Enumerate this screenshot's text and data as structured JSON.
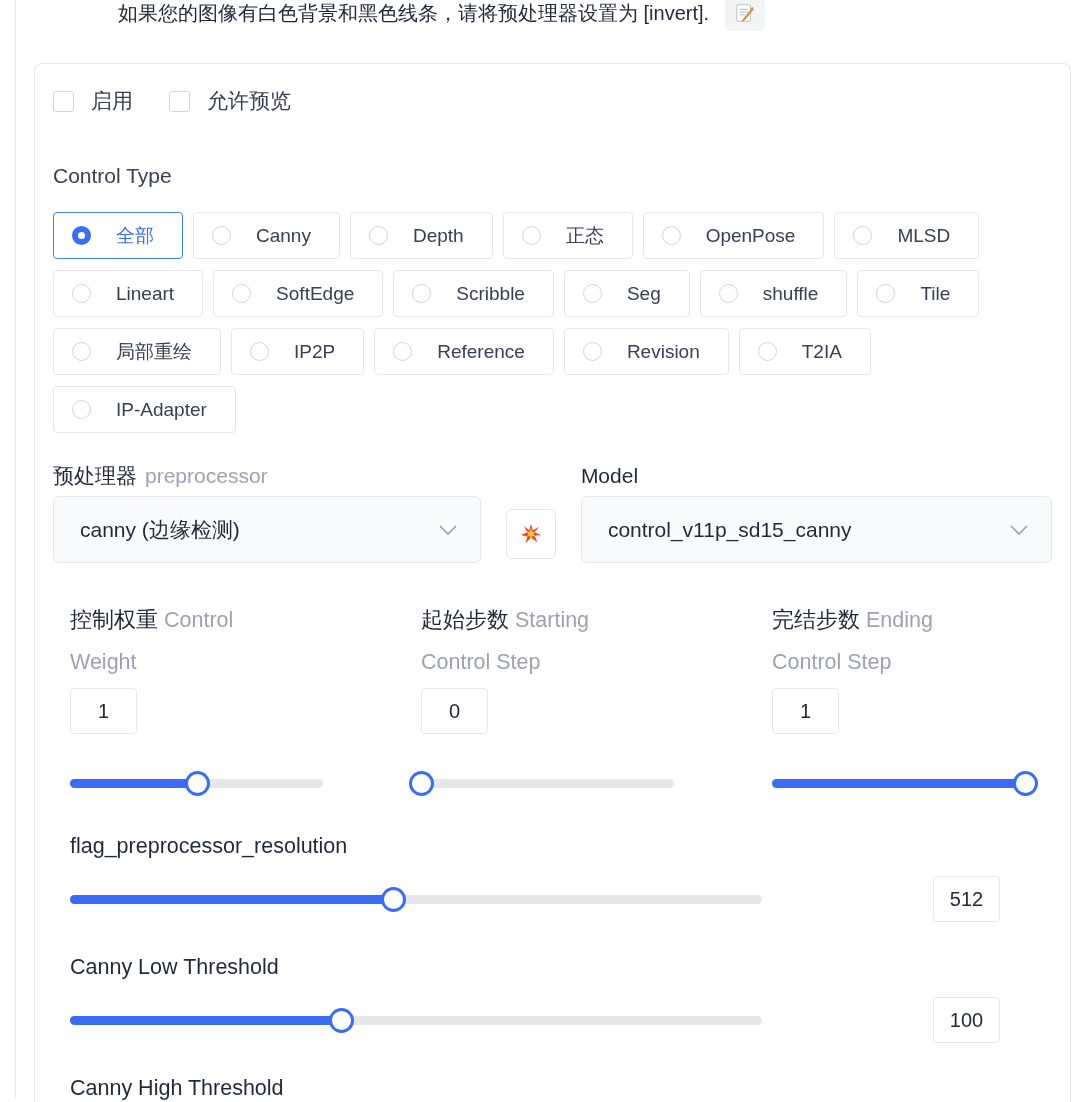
{
  "note": {
    "text": "如果您的图像有白色背景和黑色线条，请将预处理器设置为 [invert]."
  },
  "options": [
    {
      "label": "启用",
      "checked": false
    },
    {
      "label": "允许预览",
      "checked": false
    }
  ],
  "control_type": {
    "label": "Control Type",
    "types": [
      {
        "label": "全部",
        "selected": true
      },
      {
        "label": "Canny",
        "selected": false
      },
      {
        "label": "Depth",
        "selected": false
      },
      {
        "label": "正态",
        "selected": false
      },
      {
        "label": "OpenPose",
        "selected": false
      },
      {
        "label": "MLSD",
        "selected": false
      },
      {
        "label": "Lineart",
        "selected": false
      },
      {
        "label": "SoftEdge",
        "selected": false
      },
      {
        "label": "Scribble",
        "selected": false
      },
      {
        "label": "Seg",
        "selected": false
      },
      {
        "label": "shuffle",
        "selected": false
      },
      {
        "label": "Tile",
        "selected": false
      },
      {
        "label": "局部重绘",
        "selected": false
      },
      {
        "label": "IP2P",
        "selected": false
      },
      {
        "label": "Reference",
        "selected": false
      },
      {
        "label": "Revision",
        "selected": false
      },
      {
        "label": "T2IA",
        "selected": false
      },
      {
        "label": "IP-Adapter",
        "selected": false
      }
    ]
  },
  "preprocessor": {
    "label": "预处理器",
    "hint": "preprocessor",
    "value": "canny (边缘检测)"
  },
  "model": {
    "label": "Model",
    "value": "control_v11p_sd15_canny"
  },
  "step_sliders": [
    {
      "label": "控制权重",
      "hint": "Control Weight",
      "value": "1",
      "level": 0.5
    },
    {
      "label": "起始步数",
      "hint": "Starting Control Step",
      "value": "0",
      "level": 0
    },
    {
      "label": "完结步数",
      "hint": "Ending Control Step",
      "value": "1",
      "level": 1
    }
  ],
  "sliders": [
    {
      "label": "flag_preprocessor_resolution",
      "value": "512",
      "level": 0.467
    },
    {
      "label": "Canny Low Threshold",
      "value": "100",
      "level": 0.392
    },
    {
      "label": "Canny High Threshold"
    }
  ]
}
